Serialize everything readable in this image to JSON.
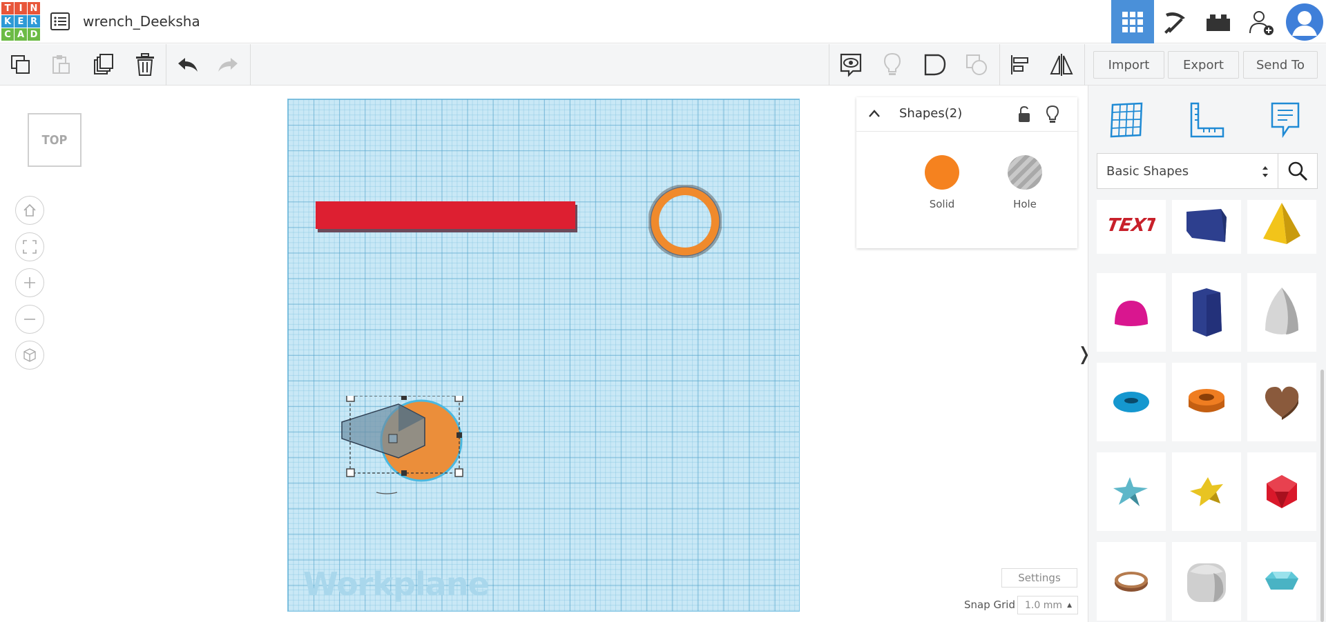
{
  "app": {
    "logo_letters": [
      "T",
      "I",
      "N",
      "K",
      "E",
      "R",
      "C",
      "A",
      "D"
    ],
    "logo_colors": [
      "#e8563a",
      "#e8563a",
      "#e8563a",
      "#2e9ad6",
      "#2e9ad6",
      "#2e9ad6",
      "#6cbb45",
      "#6cbb45",
      "#6cbb45"
    ],
    "design_title": "wrench_Deeksha"
  },
  "header_right": {
    "buttons": [
      "grid-view-icon",
      "pickaxe-icon",
      "bricks-icon",
      "add-user-icon",
      "user-avatar"
    ]
  },
  "toolbar": {
    "left_icons": [
      "copy-icon",
      "paste-icon",
      "duplicate-icon",
      "delete-icon",
      "undo-icon",
      "redo-icon"
    ],
    "right_icons": [
      "show-hide-icon",
      "light-bulb-icon",
      "group-icon",
      "ungroup-icon",
      "align-icon",
      "mirror-icon"
    ],
    "import_label": "Import",
    "export_label": "Export",
    "send_to_label": "Send To"
  },
  "viewcube": {
    "label": "TOP"
  },
  "workplane": {
    "label": "Workplane"
  },
  "inspector": {
    "title": "Shapes(2)",
    "solid_label": "Solid",
    "hole_label": "Hole",
    "solid_color": "#f5821f"
  },
  "settings": {
    "settings_label": "Settings",
    "snap_grid_label": "Snap Grid",
    "snap_grid_value": "1.0 mm"
  },
  "library": {
    "category": "Basic Shapes",
    "shapes": [
      "text-shape",
      "box-shape",
      "pyramid-shape",
      "half-sphere-shape",
      "polygon-shape",
      "paraboloid-shape",
      "torus-shape",
      "tube-shape",
      "heart-shape",
      "star-shape",
      "star-six-shape",
      "icosahedron-shape",
      "ring-shape",
      "rounded-cube-shape",
      "gem-shape"
    ]
  }
}
